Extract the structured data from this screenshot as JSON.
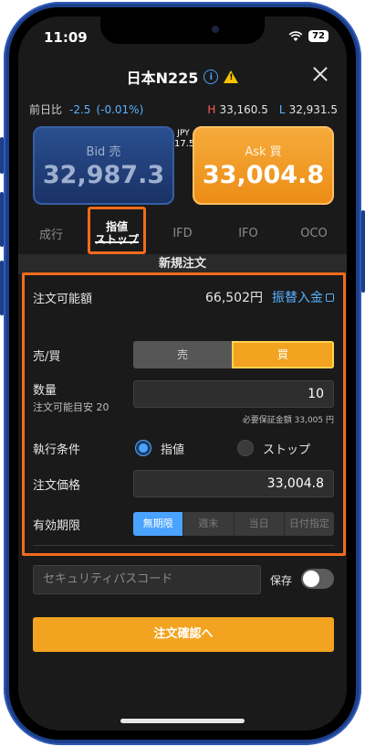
{
  "status_bar": {
    "time": "11:09",
    "battery": "72",
    "wifi_icon": "wifi-icon",
    "signal_icon": "signal-icon"
  },
  "header": {
    "title": "日本N225",
    "info_icon": "info-icon",
    "warning_icon": "warning-icon",
    "close_icon": "close-icon"
  },
  "quote": {
    "change_label": "前日比",
    "change_value": "-2.5",
    "change_pct": "(-0.01%)",
    "high_label": "H",
    "high_value": "33,160.5",
    "low_label": "L",
    "low_value": "32,931.5"
  },
  "prices": {
    "bid_label": "Bid 売",
    "bid_value": "32,987.3",
    "ask_label": "Ask 買",
    "ask_value": "33,004.8",
    "spread_currency": "JPY",
    "spread_value": "17.5"
  },
  "order_tabs": {
    "market": "成行",
    "limit_line1": "指値",
    "limit_line2": "ストップ",
    "ifd": "IFD",
    "ifo": "IFO",
    "oco": "OCO",
    "active": "limit-stop"
  },
  "section_title": "新規注文",
  "form": {
    "available_label": "注文可能額",
    "available_amount": "66,502円",
    "transfer_link": "振替入金",
    "side_label": "売/買",
    "sell_label": "売",
    "buy_label": "買",
    "selected_side": "buy",
    "qty_label": "数量",
    "qty_hint": "注文可能目安 20",
    "qty_value": "10",
    "margin_note": "必要保証金額  33,005 円",
    "exec_label": "執行条件",
    "exec_limit": "指値",
    "exec_stop": "ストップ",
    "selected_exec": "limit",
    "price_label": "注文価格",
    "price_value": "33,004.8",
    "expiry_label": "有効期限",
    "expiry_options": [
      "無期限",
      "週末",
      "当日",
      "日付指定"
    ],
    "selected_expiry": "無期限"
  },
  "security": {
    "placeholder": "セキュリティパスコード",
    "save_label": "保存",
    "save_enabled": false
  },
  "confirm_button": "注文確認へ",
  "colors": {
    "accent_orange": "#f2a320",
    "bid_blue": "#2a4f8f",
    "link_blue": "#5ab1ff",
    "highlight": "#f26b1d"
  }
}
